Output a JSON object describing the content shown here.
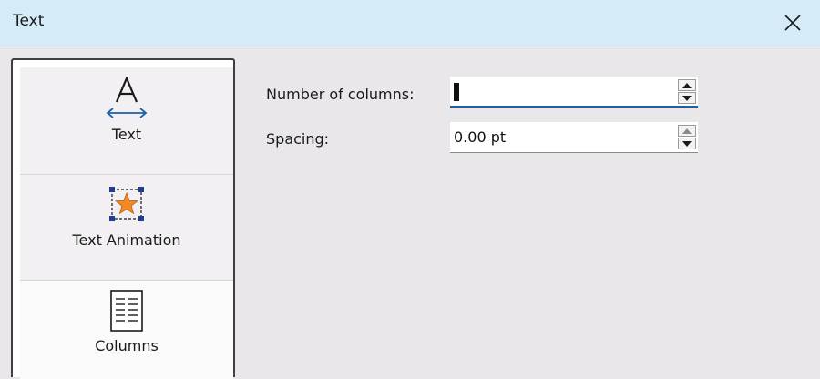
{
  "window": {
    "title": "Text",
    "close_icon": "close-icon"
  },
  "sidebar": {
    "items": [
      {
        "label": "Text",
        "icon": "text-icon",
        "selected": false
      },
      {
        "label": "Text Animation",
        "icon": "text-animation-icon",
        "selected": false
      },
      {
        "label": "Columns",
        "icon": "columns-icon",
        "selected": true
      }
    ]
  },
  "form": {
    "columns": {
      "label": "Number of columns:",
      "value": ""
    },
    "spacing": {
      "label": "Spacing:",
      "value": "0.00 pt"
    }
  },
  "colors": {
    "titlebar": "#d6ebf8",
    "accent": "#1f5fa8",
    "star": "#f08a24"
  }
}
